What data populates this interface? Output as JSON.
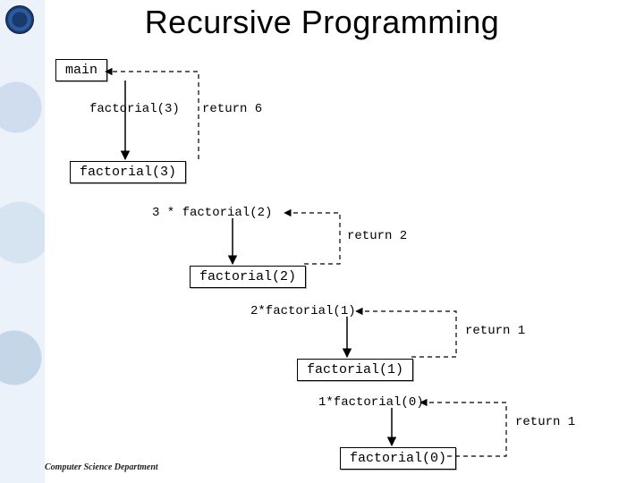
{
  "title": "Recursive Programming",
  "footer": "Computer Science Department",
  "boxes": {
    "main": "main",
    "f3": "factorial(3)",
    "f2": "factorial(2)",
    "f1": "factorial(1)",
    "f0": "factorial(0)"
  },
  "labels": {
    "call_f3": "factorial(3)",
    "ret6": "return 6",
    "expr3": "3 * factorial(2)",
    "ret2": "return 2",
    "expr2": "2*factorial(1)",
    "ret1a": "return 1",
    "expr1": "1*factorial(0)",
    "ret1b": "return 1"
  }
}
